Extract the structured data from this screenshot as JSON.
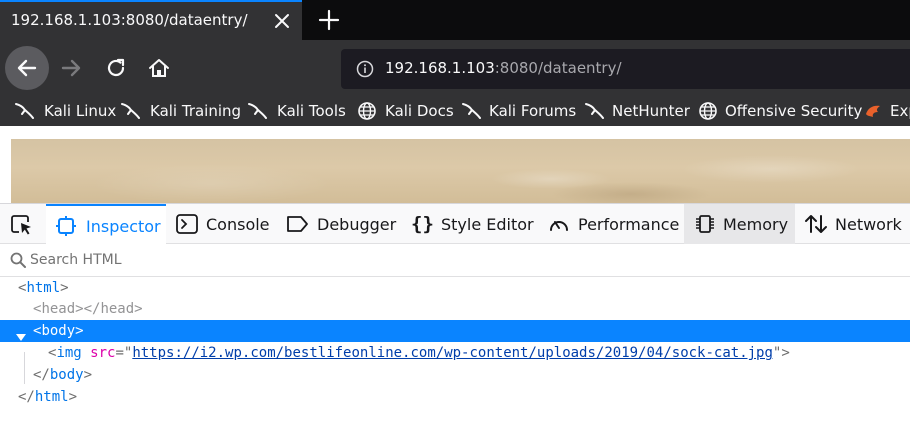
{
  "tab": {
    "title": "192.168.1.103:8080/dataentry/"
  },
  "navbar": {
    "url_host": "192.168.1.103",
    "url_rest": ":8080/dataentry/"
  },
  "bookmarks": [
    {
      "label": "Kali Linux",
      "icon": "kali-dragon-icon"
    },
    {
      "label": "Kali Training",
      "icon": "kali-dragon-icon"
    },
    {
      "label": "Kali Tools",
      "icon": "kali-dragon-icon"
    },
    {
      "label": "Kali Docs",
      "icon": "globe-icon"
    },
    {
      "label": "Kali Forums",
      "icon": "kali-dragon-icon"
    },
    {
      "label": "NetHunter",
      "icon": "kali-dragon-icon"
    },
    {
      "label": "Offensive Security",
      "icon": "globe-icon"
    },
    {
      "label": "Exp",
      "icon": "exploit-db-icon"
    }
  ],
  "devtools": {
    "tabs": [
      {
        "label": "Inspector",
        "icon": "inspector-icon"
      },
      {
        "label": "Console",
        "icon": "console-icon"
      },
      {
        "label": "Debugger",
        "icon": "debugger-icon"
      },
      {
        "label": "Style Editor",
        "icon": "braces-icon"
      },
      {
        "label": "Performance",
        "icon": "performance-gauge-icon"
      },
      {
        "label": "Memory",
        "icon": "memory-chip-icon"
      },
      {
        "label": "Network",
        "icon": "network-arrows-icon"
      }
    ],
    "active_tab": "Inspector",
    "search_placeholder": "Search HTML"
  },
  "markup": {
    "html_tag": "html",
    "head_tag": "head",
    "body_tag": "body",
    "img_tag": "img",
    "img_attr": "src",
    "img_src": "https://i2.wp.com/bestlifeonline.com/wp-content/uploads/2019/04/sock-cat.jpg"
  },
  "colors": {
    "accent": "#0a84ff",
    "toolbar_dark": "#323234",
    "tabstrip": "#0c0c0d",
    "image_sand": "#d8c5a4"
  }
}
